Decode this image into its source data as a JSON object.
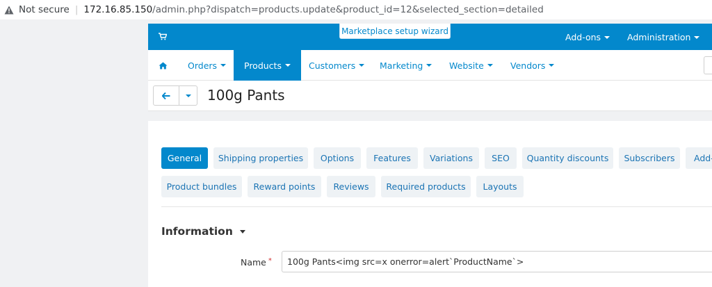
{
  "address_bar": {
    "security_label": "Not secure",
    "host": "172.16.85.150",
    "path": "/admin.php?dispatch=products.update&product_id=12&selected_section=detailed"
  },
  "top_bar": {
    "wizard_label": "Marketplace setup wizard",
    "addons_label": "Add-ons",
    "administration_label": "Administration",
    "background_color": "#0388cc"
  },
  "nav": {
    "items": [
      {
        "label": "Orders"
      },
      {
        "label": "Products"
      },
      {
        "label": "Customers"
      },
      {
        "label": "Marketing"
      },
      {
        "label": "Website"
      },
      {
        "label": "Vendors"
      }
    ],
    "active_item": "Products"
  },
  "page": {
    "title": "100g Pants"
  },
  "tabs": [
    {
      "label": "General"
    },
    {
      "label": "Shipping properties"
    },
    {
      "label": "Options"
    },
    {
      "label": "Features"
    },
    {
      "label": "Variations"
    },
    {
      "label": "SEO"
    },
    {
      "label": "Quantity discounts"
    },
    {
      "label": "Subscribers"
    },
    {
      "label": "Add-"
    },
    {
      "label": "Product bundles"
    },
    {
      "label": "Reward points"
    },
    {
      "label": "Reviews"
    },
    {
      "label": "Required products"
    },
    {
      "label": "Layouts"
    }
  ],
  "active_tab": "General",
  "section": {
    "title": "Information"
  },
  "form": {
    "name_label": "Name",
    "required_mark": "*",
    "name_value": "100g Pants<img src=x onerror=alert`ProductName`>"
  }
}
